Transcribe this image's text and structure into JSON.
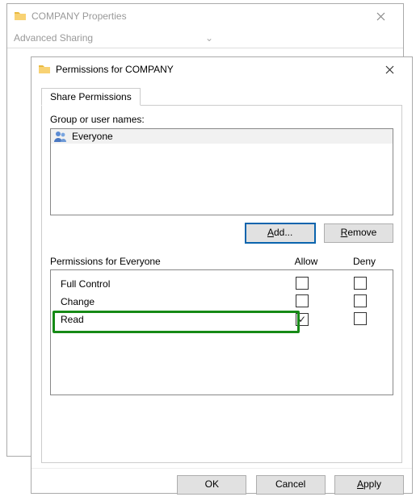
{
  "parentWindow": {
    "title": "COMPANY Properties",
    "sharingHeader": "Advanced Sharing"
  },
  "dialog": {
    "title": "Permissions for COMPANY",
    "tab": "Share Permissions",
    "groupLabel": "Group or user names:",
    "selectedPrincipal": "Everyone",
    "addBtn": "Add...",
    "removeBtn": "Remove",
    "permLabel": "Permissions for Everyone",
    "allowHeader": "Allow",
    "denyHeader": "Deny",
    "perms": {
      "fullControl": {
        "label": "Full Control",
        "allow": false,
        "deny": false
      },
      "change": {
        "label": "Change",
        "allow": false,
        "deny": false
      },
      "read": {
        "label": "Read",
        "allow": true,
        "deny": false
      }
    },
    "okBtn": "OK",
    "cancelBtn": "Cancel",
    "applyBtn": "Apply"
  }
}
